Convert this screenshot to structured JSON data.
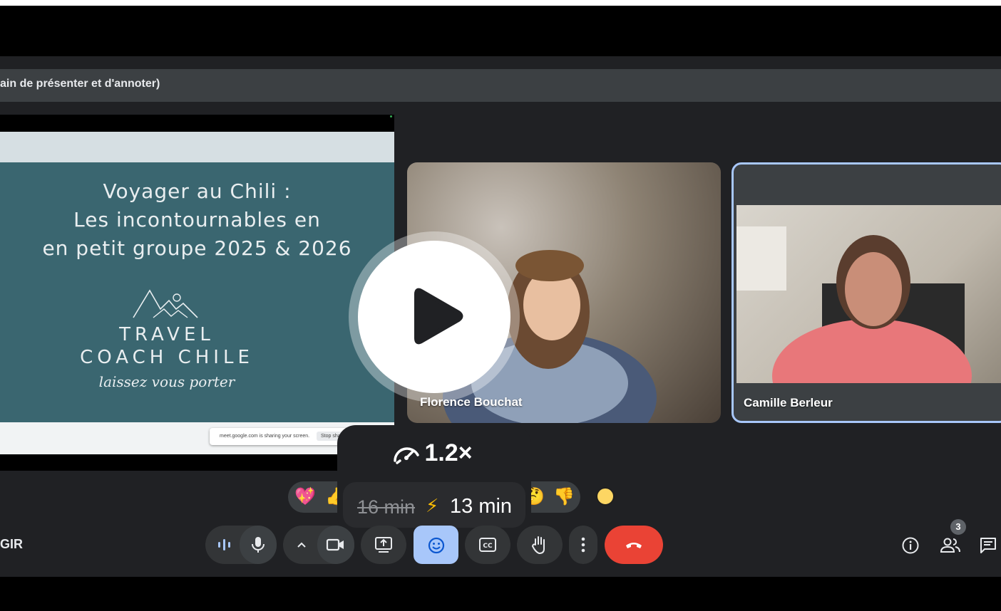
{
  "presentation_bar": {
    "text": "ain de présenter et d'annoter)"
  },
  "slide": {
    "title_line1": "Voyager au Chili :",
    "title_line2": "Les incontournables en",
    "title_line3": "en petit groupe 2025 & 2026",
    "brand_line1": "TRAVEL",
    "brand_line2": "COACH CHILE",
    "tagline": "laissez vous porter"
  },
  "sharing_notice": {
    "text": "meet.google.com is sharing your screen.",
    "button": "Stop sharing"
  },
  "participants": [
    {
      "name": "Florence Bouchat"
    },
    {
      "name": "Camille Berleur"
    }
  ],
  "playback": {
    "speed": "1.2×",
    "original_duration": "16 min",
    "bolt": "⚡",
    "new_duration": "13 min"
  },
  "reactions": [
    "💖",
    "👍",
    "🤔",
    "👎"
  ],
  "left_label": "GIR",
  "people_count": "3",
  "colors": {
    "meet_bg": "#202124",
    "end_call": "#ea4335",
    "active_button": "#a8c7fa",
    "tile_border": "#a8c7fa"
  }
}
